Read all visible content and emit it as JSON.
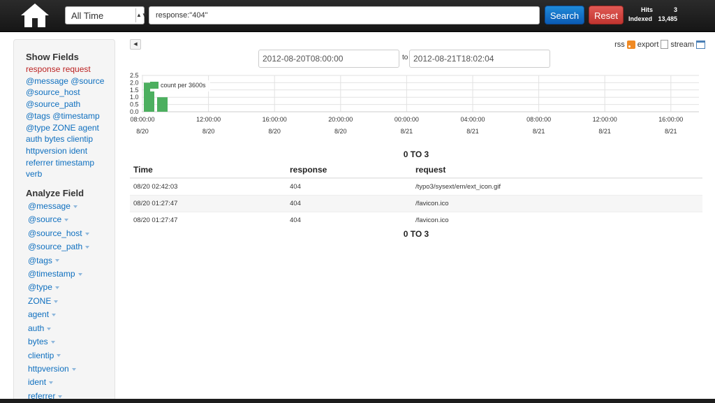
{
  "topbar": {
    "time_range": "All Time",
    "query": "response:\"404\"",
    "search_label": "Search",
    "reset_label": "Reset",
    "hits_label": "Hits",
    "hits_value": "3",
    "indexed_label": "Indexed",
    "indexed_value": "13,485"
  },
  "sidebar": {
    "show_fields_title": "Show Fields",
    "show_fields_lines": [
      "response request",
      "@message @source",
      "@source_host",
      "@source_path",
      "@tags @timestamp",
      "@type ZONE agent",
      "auth bytes clientip",
      "httpversion ident",
      "referrer timestamp",
      "verb"
    ],
    "analyze_title": "Analyze Field",
    "analyze_items": [
      "@message",
      "@source",
      "@source_host",
      "@source_path",
      "@tags",
      "@timestamp",
      "@type",
      "ZONE",
      "agent",
      "auth",
      "bytes",
      "clientip",
      "httpversion",
      "ident",
      "referrer"
    ]
  },
  "tools": {
    "rss": "rss",
    "export": "export",
    "stream": "stream"
  },
  "dates": {
    "from": "2012-08-20T08:00:00",
    "to_label": "to",
    "to": "2012-08-21T18:02:04"
  },
  "chart_data": {
    "type": "bar",
    "legend": "count per 3600s",
    "ylim": [
      0,
      2.5
    ],
    "yticks": [
      "2.5",
      "2.0",
      "1.5",
      "1.0",
      "0.5",
      "0.0"
    ],
    "xticks": [
      {
        "time": "08:00:00",
        "date": "8/20"
      },
      {
        "time": "12:00:00",
        "date": "8/20"
      },
      {
        "time": "16:00:00",
        "date": "8/20"
      },
      {
        "time": "20:00:00",
        "date": "8/20"
      },
      {
        "time": "00:00:00",
        "date": "8/21"
      },
      {
        "time": "04:00:00",
        "date": "8/21"
      },
      {
        "time": "08:00:00",
        "date": "8/21"
      },
      {
        "time": "12:00:00",
        "date": "8/21"
      },
      {
        "time": "16:00:00",
        "date": "8/21"
      }
    ],
    "x": [
      "2012-08-20 01:00",
      "2012-08-20 02:00"
    ],
    "values": [
      2,
      1
    ],
    "bar_color": "#4caf5f"
  },
  "results": {
    "range_top": "0 TO 3",
    "range_bottom": "0 TO 3",
    "columns": [
      "Time",
      "response",
      "request"
    ],
    "rows": [
      [
        "08/20 02:42:03",
        "404",
        "/typo3/sysext/em/ext_icon.gif"
      ],
      [
        "08/20 01:27:47",
        "404",
        "/favicon.ico"
      ],
      [
        "08/20 01:27:47",
        "404",
        "/favicon.ico"
      ]
    ]
  }
}
